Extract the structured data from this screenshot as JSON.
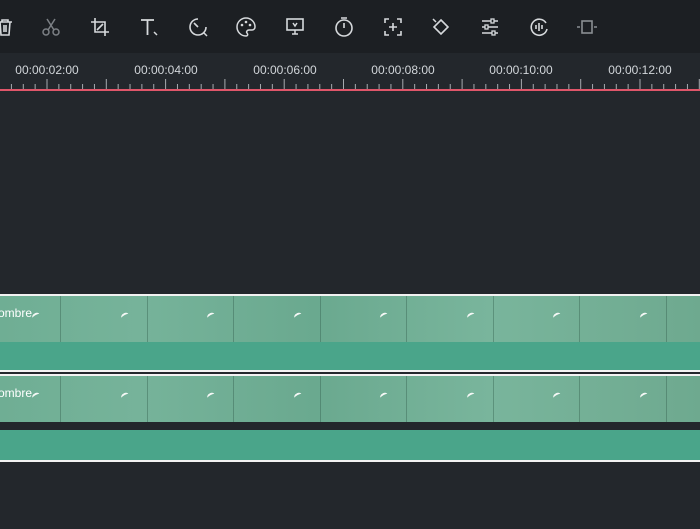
{
  "toolbar": {
    "tools": [
      {
        "name": "delete-icon"
      },
      {
        "name": "split-icon"
      },
      {
        "name": "crop-icon"
      },
      {
        "name": "text-icon"
      },
      {
        "name": "speed-icon"
      },
      {
        "name": "color-palette-icon"
      },
      {
        "name": "stabilize-icon"
      },
      {
        "name": "timer-icon"
      },
      {
        "name": "zoom-frame-icon"
      },
      {
        "name": "keyframe-icon"
      },
      {
        "name": "adjust-icon"
      },
      {
        "name": "audio-icon"
      },
      {
        "name": "freeze-frame-icon"
      }
    ]
  },
  "ruler": {
    "labels": [
      "00:00:02:00",
      "00:00:04:00",
      "00:00:06:00",
      "00:00:08:00",
      "00:00:10:00",
      "00:00:12:00"
    ]
  },
  "tracks": {
    "clip1": {
      "name": "ombre"
    },
    "clip2": {
      "name": "ombre"
    }
  },
  "colors": {
    "playhead_line": "#e0566a",
    "clip_video": "#6fae94",
    "clip_audio": "#4aa58a",
    "background": "#23272c"
  }
}
